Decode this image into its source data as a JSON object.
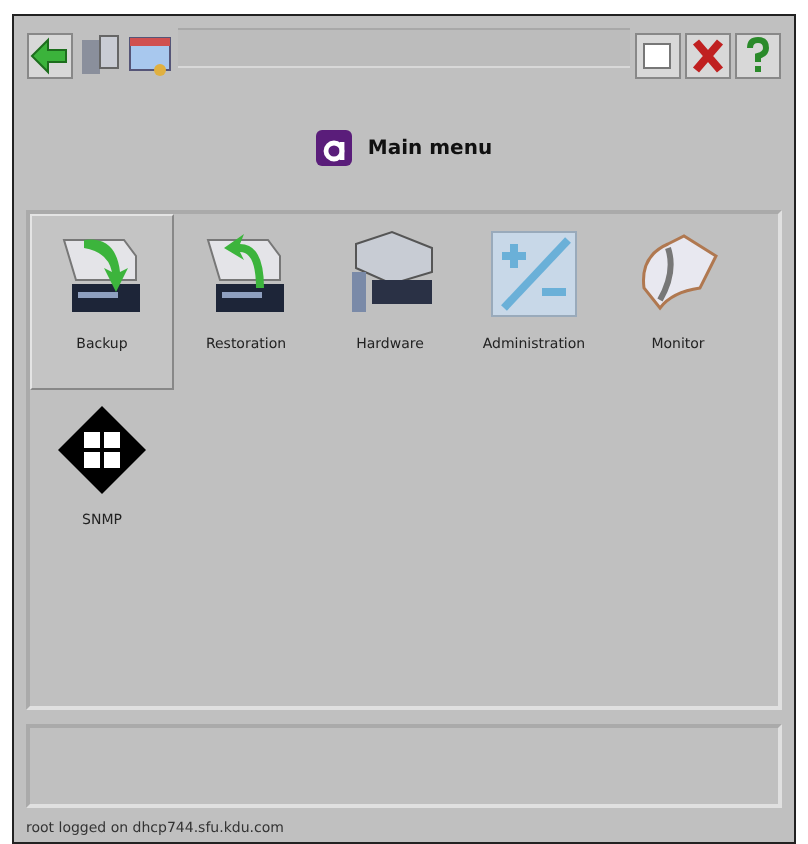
{
  "title": "Main menu",
  "items": [
    {
      "label": "Backup",
      "selected": true
    },
    {
      "label": "Restoration",
      "selected": false
    },
    {
      "label": "Hardware",
      "selected": false
    },
    {
      "label": "Administration",
      "selected": false
    },
    {
      "label": "Monitor",
      "selected": false
    },
    {
      "label": "SNMP",
      "selected": false
    }
  ],
  "status_bar": "root logged on dhcp744.sfu.kdu.com"
}
